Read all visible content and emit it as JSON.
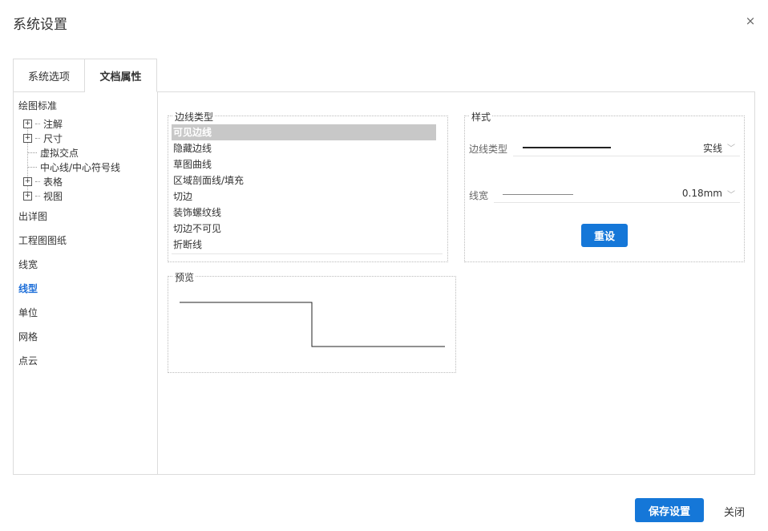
{
  "dialog": {
    "title": "系统设置",
    "close_glyph": "×"
  },
  "tabs": [
    {
      "label": "系统选项"
    },
    {
      "label": "文档属性"
    }
  ],
  "sidebar": {
    "root": "绘图标准",
    "tree": [
      {
        "label": "注解",
        "expandable": true
      },
      {
        "label": "尺寸",
        "expandable": true
      },
      {
        "label": "虚拟交点",
        "expandable": false
      },
      {
        "label": "中心线/中心符号线",
        "expandable": false
      },
      {
        "label": "表格",
        "expandable": true
      },
      {
        "label": "视图",
        "expandable": true
      }
    ],
    "items": [
      {
        "label": "出详图"
      },
      {
        "label": "工程图图纸"
      },
      {
        "label": "线宽"
      },
      {
        "label": "线型"
      },
      {
        "label": "单位"
      },
      {
        "label": "网格"
      },
      {
        "label": "点云"
      }
    ],
    "active_item": "线型"
  },
  "edge_types": {
    "legend": "边线类型",
    "items": [
      "可见边线",
      "隐藏边线",
      "草图曲线",
      "区域剖面线/填充",
      "切边",
      "装饰螺纹线",
      "切边不可见",
      "折断线"
    ],
    "selected": "可见边线"
  },
  "style": {
    "legend": "样式",
    "line_type_label": "边线类型",
    "line_type_value": "实线",
    "line_width_label": "线宽",
    "line_width_value": "0.18mm",
    "reset_label": "重设"
  },
  "preview": {
    "legend": "预览"
  },
  "footer": {
    "save_label": "保存设置",
    "close_label": "关闭"
  },
  "colors": {
    "accent": "#1577d8",
    "active_nav": "#1e6fd9",
    "selected_row": "#c8c8c8"
  },
  "icons": {
    "close": "close-icon",
    "expand": "plus-box-icon",
    "dropdown": "chevron-down-icon"
  }
}
